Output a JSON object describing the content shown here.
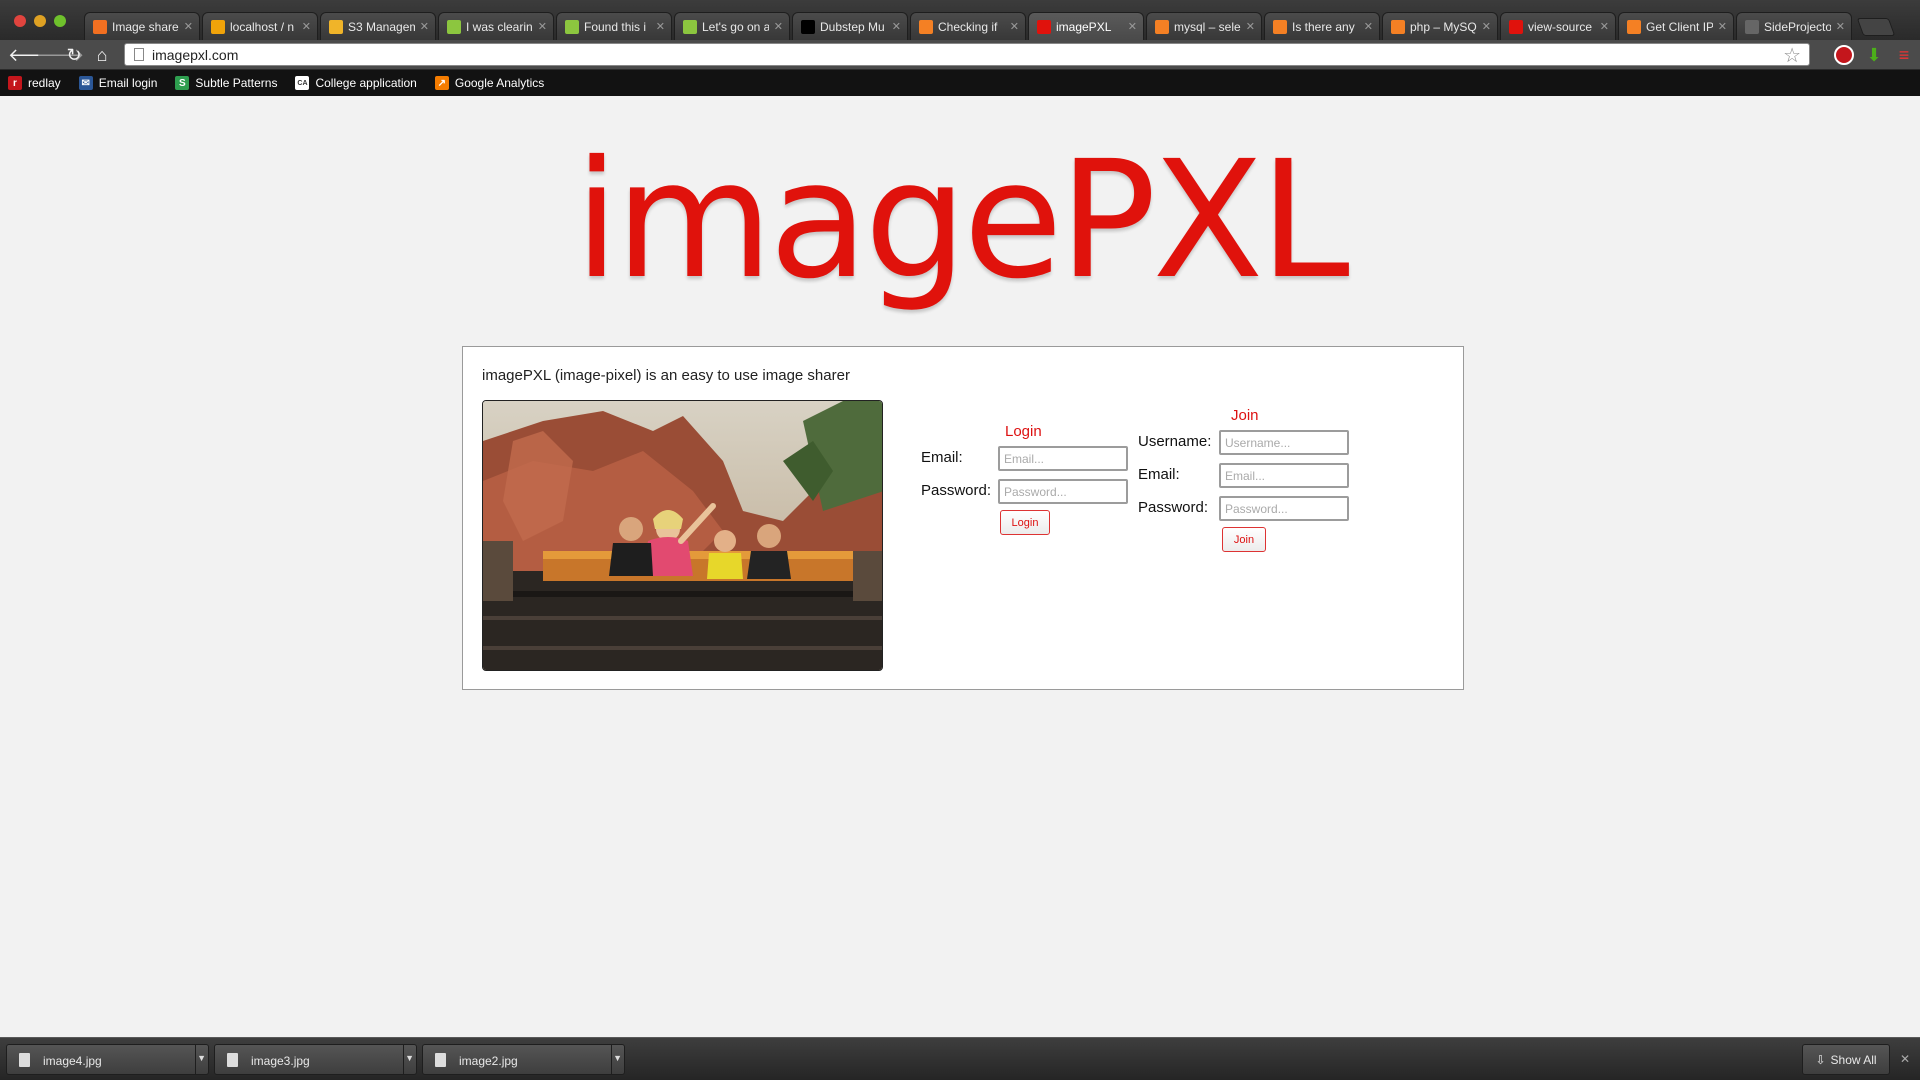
{
  "browser": {
    "tabs": [
      {
        "title": "Image share",
        "favicon_color": "#f37021"
      },
      {
        "title": "localhost / n",
        "favicon_color": "#f0a30a"
      },
      {
        "title": "S3 Managem",
        "favicon_color": "#f0b429"
      },
      {
        "title": "I was clearin",
        "favicon_color": "#8cc63f"
      },
      {
        "title": "Found this i",
        "favicon_color": "#8cc63f"
      },
      {
        "title": "Let's go on a",
        "favicon_color": "#8cc63f"
      },
      {
        "title": "Dubstep Mu",
        "favicon_color": "#000000"
      },
      {
        "title": "Checking if",
        "favicon_color": "#f48024"
      },
      {
        "title": "imagePXL",
        "favicon_color": "#e0120c",
        "active": true
      },
      {
        "title": "mysql – sele",
        "favicon_color": "#f48024"
      },
      {
        "title": "Is there any",
        "favicon_color": "#f48024"
      },
      {
        "title": "php – MySQ",
        "favicon_color": "#f48024"
      },
      {
        "title": "view-source",
        "favicon_color": "#e0120c"
      },
      {
        "title": "Get Client IP",
        "favicon_color": "#f48024"
      },
      {
        "title": "SideProjecto",
        "favicon_color": "#666666"
      }
    ],
    "url": "imagepxl.com",
    "bookmarks": [
      {
        "label": "redlay",
        "icon_char": "r",
        "icon_color": "#c4161c"
      },
      {
        "label": "Email login",
        "icon_char": "✉",
        "icon_color": "#2b5797"
      },
      {
        "label": "Subtle Patterns",
        "icon_char": "S",
        "icon_color": "#2e9e4f"
      },
      {
        "label": "College application",
        "icon_char": "CA",
        "icon_color": "#ffffff"
      },
      {
        "label": "Google Analytics",
        "icon_char": "↗",
        "icon_color": "#f57c00"
      }
    ]
  },
  "page": {
    "logo": "imagePXL",
    "tagline": "imagePXL (image-pixel) is an easy to use image sharer",
    "login": {
      "title": "Login",
      "email_label": "Email:",
      "email_placeholder": "Email...",
      "password_label": "Password:",
      "password_placeholder": "Password...",
      "button": "Login"
    },
    "join": {
      "title": "Join",
      "username_label": "Username:",
      "username_placeholder": "Username...",
      "email_label": "Email:",
      "email_placeholder": "Email...",
      "password_label": "Password:",
      "password_placeholder": "Password...",
      "button": "Join"
    },
    "accent_color": "#e0120c"
  },
  "downloads": {
    "items": [
      {
        "name": "image4.jpg"
      },
      {
        "name": "image3.jpg"
      },
      {
        "name": "image2.jpg"
      }
    ],
    "show_all": "Show All"
  }
}
